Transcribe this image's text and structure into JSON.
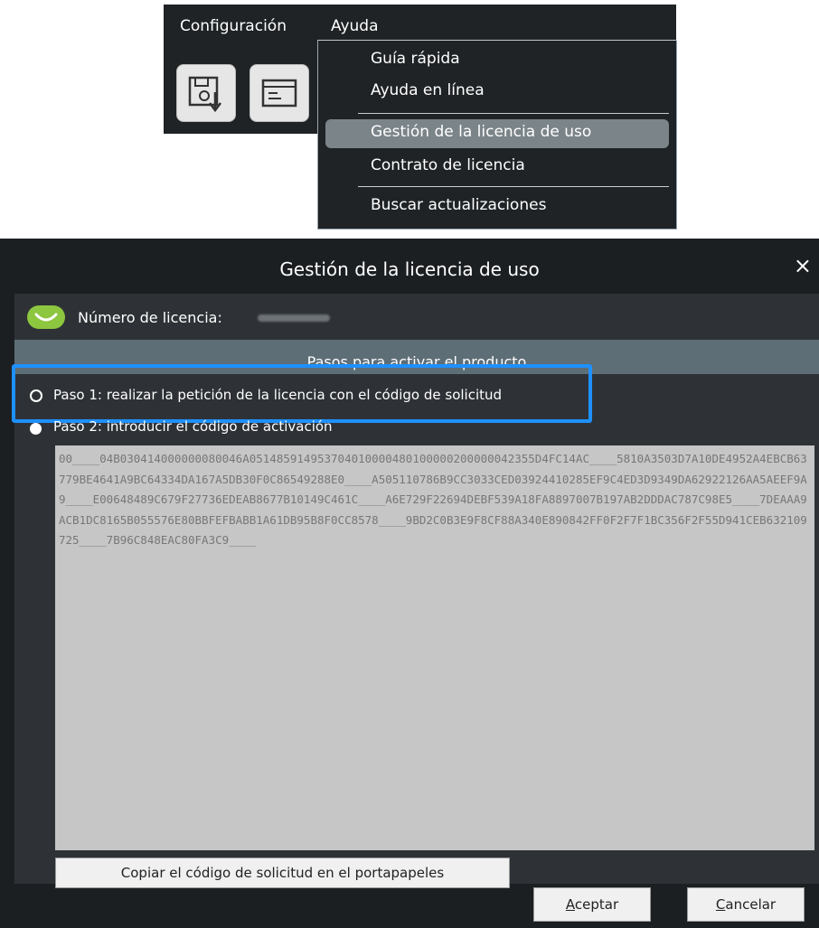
{
  "menubar": {
    "menus": [
      "Configuración",
      "Ayuda"
    ],
    "toolbar_icons": [
      "save-export-icon",
      "form-window-icon"
    ]
  },
  "dropdown": {
    "items": [
      "Guía rápida",
      "Ayuda en línea",
      "Gestión de la licencia de uso",
      "Contrato de licencia",
      "Buscar actualizaciones"
    ],
    "highlighted": "Gestión de la licencia de uso"
  },
  "dialog": {
    "title": "Gestión de la licencia de uso",
    "close_glyph": "×",
    "license_label": "Número de licencia:",
    "steps_header": "Pasos para activar el producto",
    "step1": "Paso 1: realizar la petición de la licencia con el código de solicitud",
    "step2": "Paso 2: introducir el código de activación",
    "request_code": "00____04B030414000000080046A051485914953704010000480100000200000042355D4FC14AC____5810A3503D7A10DE4952A4EBCB63779BE4641A9BC64334DA167A5DB30F0C86549288E0____A505110786B9CC3033CED03924410285EF9C4ED3D9349DA62922126AA5AEEF9A9____E00648489C679F27736EDEAB8677B10149C461C____A6E729F22694DEBF539A18FA8897007B197AB2DDDAC787C98E5____7DEAAA9ACB1DC8165B055576E80BBFEFBABB1A61DB95B8F0CC8578____9BD2C0B3E9F8CF88A340E890842FF0F2F7F1BC356F2F55D941CEB632109725____7B96C848EAC80FA3C9____",
    "copy_button": "Copiar el código de solicitud en el portapapeles",
    "accept_underline": "A",
    "accept_rest": "ceptar",
    "cancel_underline": "C",
    "cancel_rest": "ancelar"
  },
  "colors": {
    "menu_bg": "#1f2326",
    "highlight_border": "#1e90ff",
    "license_icon": "#8dc63f",
    "steps_header_bg": "#5e6e77"
  }
}
